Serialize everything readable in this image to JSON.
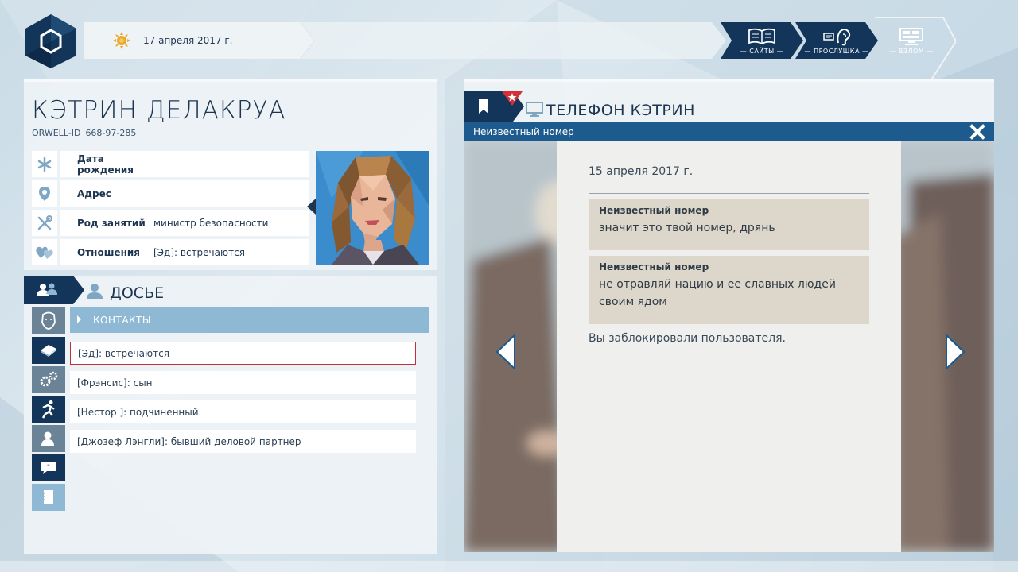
{
  "topbar": {
    "date": "17 апреля 2017 г.",
    "tools": [
      {
        "label": "— САЙТЫ —",
        "icon": "book-icon"
      },
      {
        "label": "— ПРОСЛУШКА —",
        "icon": "ear-icon"
      },
      {
        "label": "— ВЗЛОМ —",
        "icon": "computer-icon"
      }
    ]
  },
  "profile": {
    "name": "КЭТРИН ДЕЛАКРУА",
    "orwell_label": "ORWELL-ID",
    "orwell_id": "668-97-285",
    "fields": [
      {
        "label": "Дата рождения",
        "value": "",
        "icon": "asterisk-icon"
      },
      {
        "label": "Адрес",
        "value": "",
        "icon": "location-pin-icon"
      },
      {
        "label": "Род занятий",
        "value": "министр безопасности",
        "icon": "tools-icon"
      },
      {
        "label": "Отношения",
        "value": "[Эд]: встречаются",
        "icon": "hearts-icon"
      }
    ]
  },
  "dossier": {
    "title": "ДОСЬЕ",
    "section": "КОНТАКТЫ",
    "contacts": [
      "[Эд]: встречаются",
      "[Фрэнсис]: сын",
      "[Нестор ]: подчиненный",
      "[Джозеф Лэнгли]: бывший деловой партнер"
    ]
  },
  "phone": {
    "title": "ТЕЛЕФОН КЭТРИН",
    "thread": "Неизвестный номер",
    "date": "15 апреля 2017 г.",
    "messages": [
      {
        "sender": "Неизвестный номер",
        "text": "значит это твой номер, дрянь"
      },
      {
        "sender": "Неизвестный номер",
        "text": "не отравляй нацию и ее славных людей своим ядом"
      }
    ],
    "status": "Вы заблокировали пользователя."
  },
  "colors": {
    "navy": "#13355a",
    "accent_blue": "#1d5a8e",
    "selected_border": "#c0303a",
    "section_head": "#8fb8d4"
  }
}
